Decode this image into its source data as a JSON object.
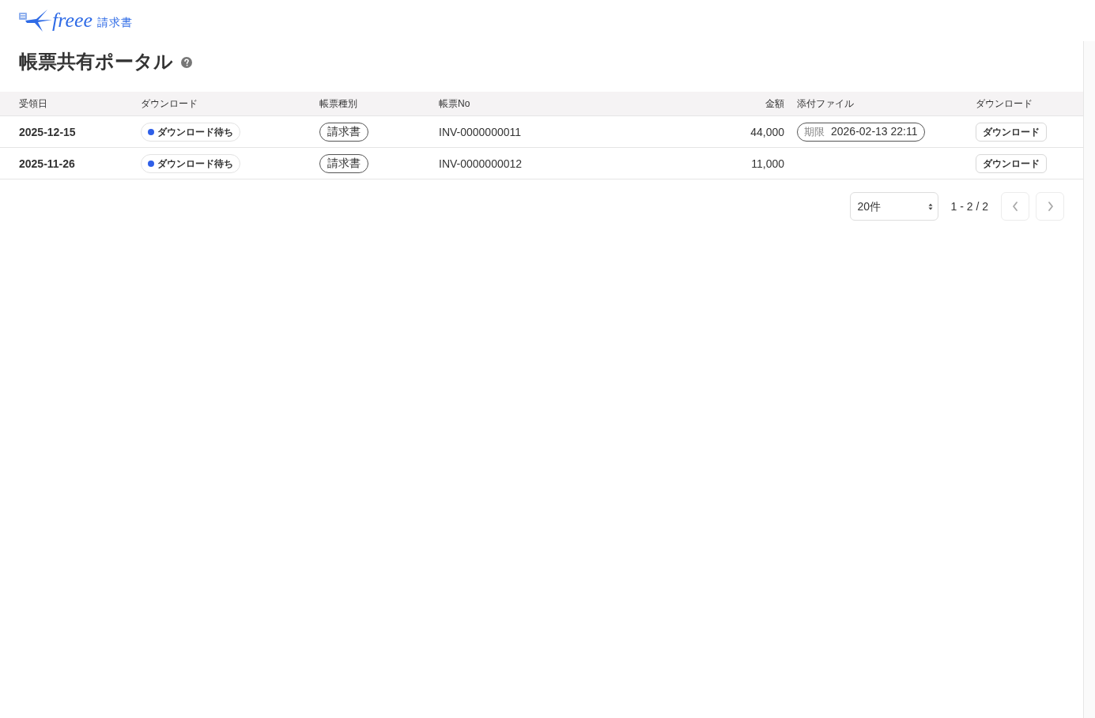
{
  "header": {
    "logo": {
      "brand": "freee",
      "product": "請求書"
    }
  },
  "page": {
    "title": "帳票共有ポータル"
  },
  "table": {
    "columns": [
      "受領日",
      "ダウンロード",
      "帳票種別",
      "帳票No",
      "金額",
      "添付ファイル",
      "ダウンロード"
    ],
    "rows": [
      {
        "received_date": "2025-12-15",
        "download_status": "ダウンロード待ち",
        "document_type": "請求書",
        "document_no": "INV-0000000011",
        "amount": "44,000",
        "attachment": {
          "label": "期限",
          "value": "2026-02-13 22:11"
        },
        "action": "ダウンロード"
      },
      {
        "received_date": "2025-11-26",
        "download_status": "ダウンロード待ち",
        "document_type": "請求書",
        "document_no": "INV-0000000012",
        "amount": "11,000",
        "action": "ダウンロード"
      }
    ]
  },
  "pagination": {
    "page_size": "20件",
    "range": "1 - 2 / 2",
    "prev": {
      "disabled": true
    },
    "next": {
      "disabled": true
    }
  }
}
